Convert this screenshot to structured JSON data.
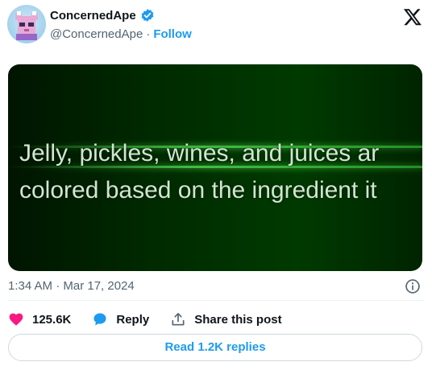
{
  "author": {
    "display_name": "ConcernedApe",
    "handle": "@ConcernedApe",
    "separator": "·",
    "follow_label": "Follow"
  },
  "media": {
    "lines": [
      "Jelly, pickles, wines, and juices ar",
      "colored based on the ingredient it"
    ]
  },
  "timestamp": "1:34 AM · Mar 17, 2024",
  "actions": {
    "likes": "125.6K",
    "reply_label": "Reply",
    "share_label": "Share this post"
  },
  "read_replies_label": "Read 1.2K replies",
  "colors": {
    "accent": "#1d9bf0",
    "like": "#f91880",
    "text_secondary": "#536471"
  },
  "icons": {
    "verified": "verified-badge-icon",
    "logo": "x-logo-icon",
    "info": "info-icon",
    "like": "heart-icon",
    "reply": "reply-bubble-icon",
    "share": "share-upload-icon"
  }
}
